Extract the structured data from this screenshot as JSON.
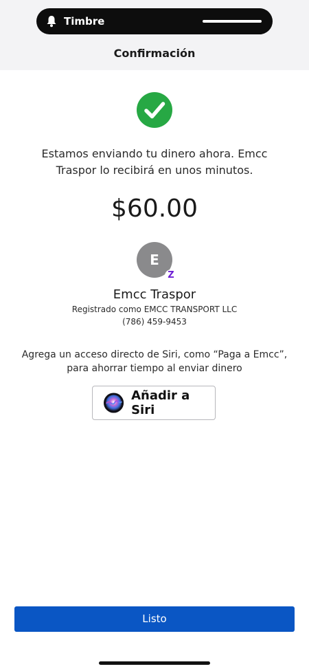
{
  "notification": {
    "label": "Timbre",
    "icon": "bell-icon"
  },
  "header": {
    "title": "Confirmación"
  },
  "status": {
    "icon": "checkmark-circle-icon",
    "color": "#27a844"
  },
  "message": "Estamos enviando tu dinero ahora. Emcc Traspor lo recibirá en unos minutos.",
  "amount": "$60.00",
  "recipient": {
    "initial": "E",
    "badge": "Z",
    "badge_icon": "zelle-icon",
    "name": "Emcc Traspor",
    "registered_as": "Registrado como EMCC TRANSPORT LLC",
    "phone": "(786) 459-9453"
  },
  "siri": {
    "description": "Agrega un acceso directo de Siri, como “Paga a Emcc”, para ahorrar tiempo al enviar dinero",
    "button_label": "Añadir a Siri",
    "icon": "siri-icon"
  },
  "footer": {
    "done_label": "Listo"
  },
  "colors": {
    "primary": "#0a56c4",
    "zelle": "#6d1ed4",
    "avatar": "#8a8a8c"
  }
}
